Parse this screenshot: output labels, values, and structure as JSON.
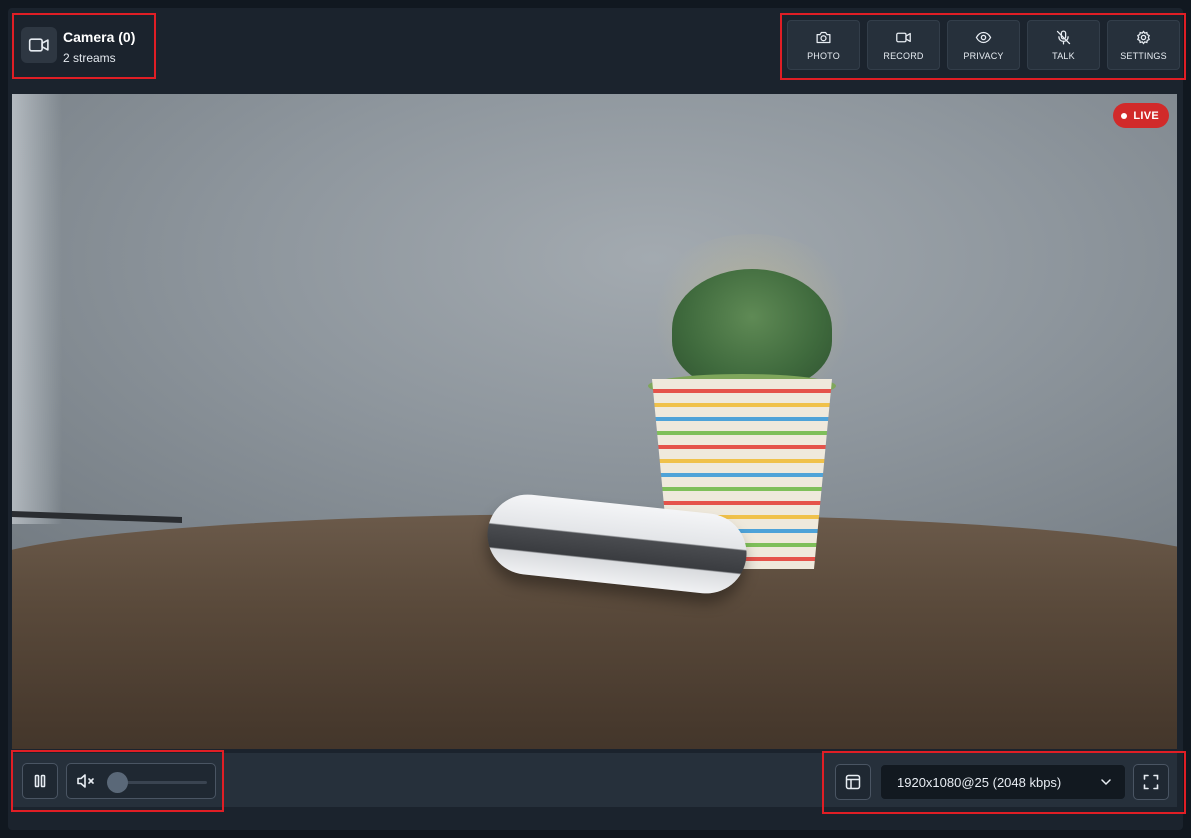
{
  "camera": {
    "title": "Camera (0)",
    "subtitle": "2 streams"
  },
  "actions": [
    {
      "label": "PHOTO",
      "icon": "camera-icon"
    },
    {
      "label": "RECORD",
      "icon": "video-icon"
    },
    {
      "label": "PRIVACY",
      "icon": "eye-icon"
    },
    {
      "label": "TALK",
      "icon": "mic-off-icon"
    },
    {
      "label": "SETTINGS",
      "icon": "gear-icon"
    }
  ],
  "video": {
    "live_label": "LIVE",
    "live_color": "#d12a2a"
  },
  "controls": {
    "pause_icon": "pause-icon",
    "mute_icon": "volume-muted-icon",
    "volume": 0,
    "layout_icon": "layout-icon",
    "quality_selected": "1920x1080@25 (2048 kbps)",
    "fullscreen_icon": "fullscreen-icon"
  },
  "colors": {
    "highlight": "#e01e25",
    "panel": "#1b232d",
    "button": "#26303b"
  }
}
